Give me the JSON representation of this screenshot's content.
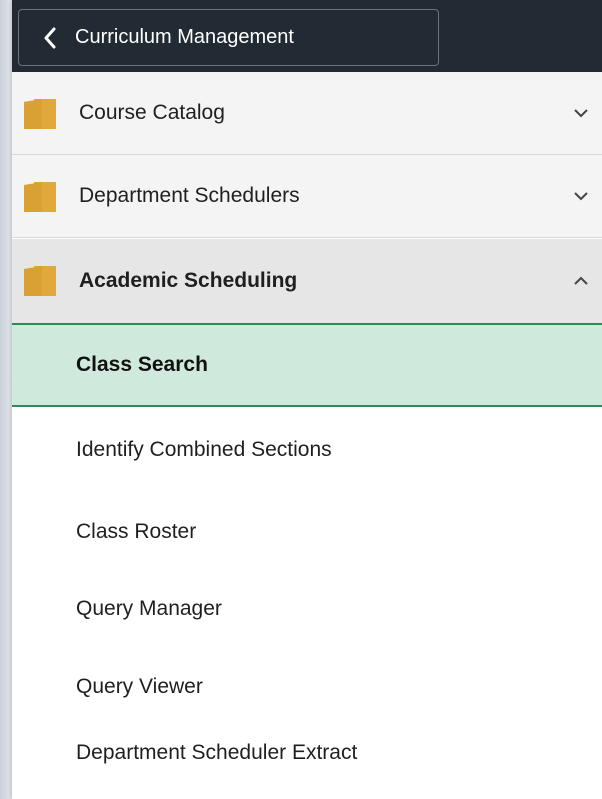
{
  "header": {
    "back_label": "Curriculum Management"
  },
  "nav": {
    "folders": [
      {
        "label": "Course Catalog",
        "state": "collapsed"
      },
      {
        "label": "Department Schedulers",
        "state": "collapsed"
      },
      {
        "label": "Academic Scheduling",
        "state": "expanded"
      }
    ],
    "items": [
      {
        "label": "Class Search",
        "selected": true
      },
      {
        "label": "Identify Combined Sections",
        "selected": false
      },
      {
        "label": "Class Roster",
        "selected": false
      },
      {
        "label": "Query Manager",
        "selected": false
      },
      {
        "label": "Query Viewer",
        "selected": false
      },
      {
        "label": "Department Scheduler Extract",
        "selected": false
      }
    ]
  },
  "colors": {
    "header_bg": "#222a33",
    "selected_bg": "#cfe9dd",
    "accent_green": "#2e8b57",
    "folder_color": "#d9a033"
  },
  "icons": {
    "back": "chevron-left-icon",
    "folder": "folder-icon",
    "collapsed": "chevron-down-icon",
    "expanded": "chevron-up-icon"
  }
}
